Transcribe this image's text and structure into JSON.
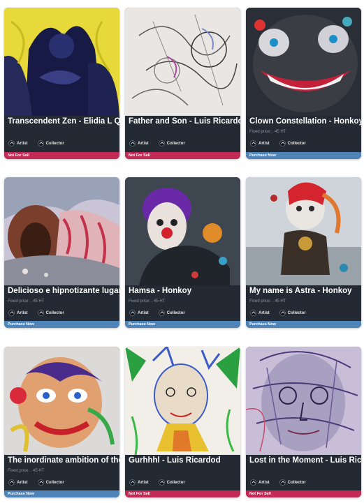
{
  "colors": {
    "card_bg": "#232a33",
    "not_for_sell": "#c42a56",
    "purchase_now": "#4e84b8"
  },
  "cards": [
    {
      "title": "Transcendent Zen - Elidia L Quin",
      "price": "",
      "artist": "Artist",
      "collector": "Collector",
      "status": "Not For Sell"
    },
    {
      "title": "Father and Son - Luis Ricardod",
      "price": "",
      "artist": "Artist",
      "collector": "Collector",
      "status": "Not For Sell"
    },
    {
      "title": "Clown Constellation - Honkoy",
      "price": "Fixed price: . 45 HT",
      "artist": "Artist",
      "collector": "Collector",
      "status": "Purchase Now"
    },
    {
      "title": "Delicioso e hipnotizante lugar! -",
      "price": "Fixed price: . 45 HT",
      "artist": "Artist",
      "collector": "Collector",
      "status": "Purchase Now"
    },
    {
      "title": "Hamsa - Honkoy",
      "price": "Fixed price: . 45 HT",
      "artist": "Artist",
      "collector": "Collector",
      "status": "Purchase Now"
    },
    {
      "title": "My name is Astra - Honkoy",
      "price": "Fixed price: . 45 HT",
      "artist": "Artist",
      "collector": "Collector",
      "status": "Purchase Now"
    },
    {
      "title": "The inordinate ambition of the c",
      "price": "Fixed price: . 45 HT",
      "artist": "Artist",
      "collector": "Collector",
      "status": "Purchase Now"
    },
    {
      "title": "Gurhhhl - Luis Ricardod",
      "price": "",
      "artist": "Artist",
      "collector": "Collector",
      "status": "Not For Sell"
    },
    {
      "title": "Lost in the Moment - Luis Ricard",
      "price": "",
      "artist": "Artist",
      "collector": "Collector",
      "status": "Not For Sell"
    }
  ]
}
